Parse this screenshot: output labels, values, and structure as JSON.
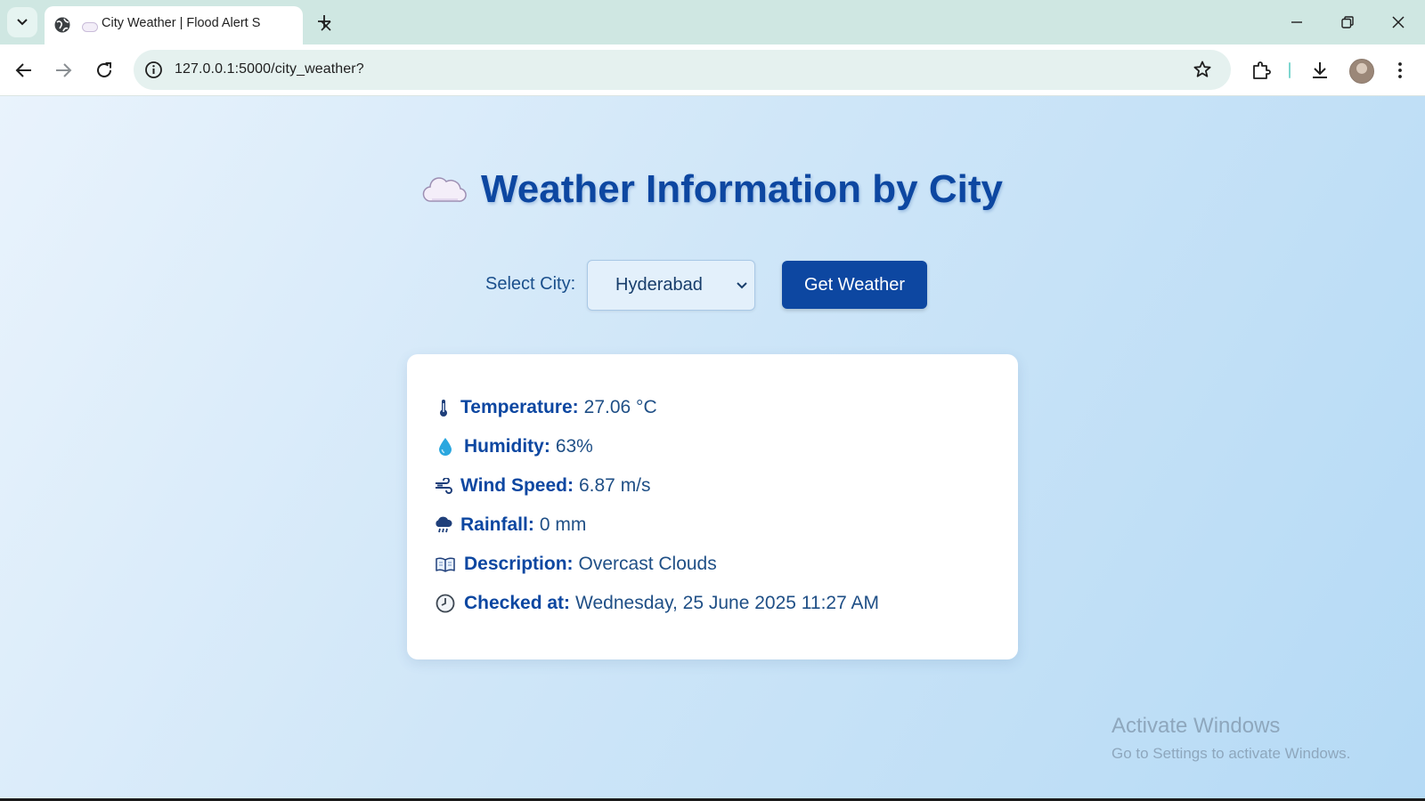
{
  "browser": {
    "tab_title": "City Weather | Flood Alert S",
    "url": "127.0.0.1:5000/city_weather?"
  },
  "page": {
    "title": "Weather Information by City",
    "select_label": "Select City:",
    "selected_city": "Hyderabad",
    "button_label": "Get Weather"
  },
  "weather": {
    "temperature": {
      "label": "Temperature:",
      "value": "27.06 °C",
      "icon": "thermometer-icon"
    },
    "humidity": {
      "label": "Humidity:",
      "value": "63%",
      "icon": "droplet-icon"
    },
    "wind": {
      "label": "Wind Speed:",
      "value": "6.87 m/s",
      "icon": "wind-icon"
    },
    "rainfall": {
      "label": "Rainfall:",
      "value": "0 mm",
      "icon": "rain-cloud-icon"
    },
    "description": {
      "label": "Description:",
      "value": "Overcast Clouds",
      "icon": "book-icon"
    },
    "checked": {
      "label": "Checked at:",
      "value": "Wednesday, 25 June 2025 11:27 AM",
      "icon": "clock-icon"
    }
  },
  "watermark": {
    "title": "Activate Windows",
    "subtitle": "Go to Settings to activate Windows."
  },
  "colors": {
    "accent": "#0d47a1",
    "tabstrip": "#cfe7e2",
    "page_bg_start": "#e9f3fc",
    "page_bg_end": "#b5daf5"
  }
}
